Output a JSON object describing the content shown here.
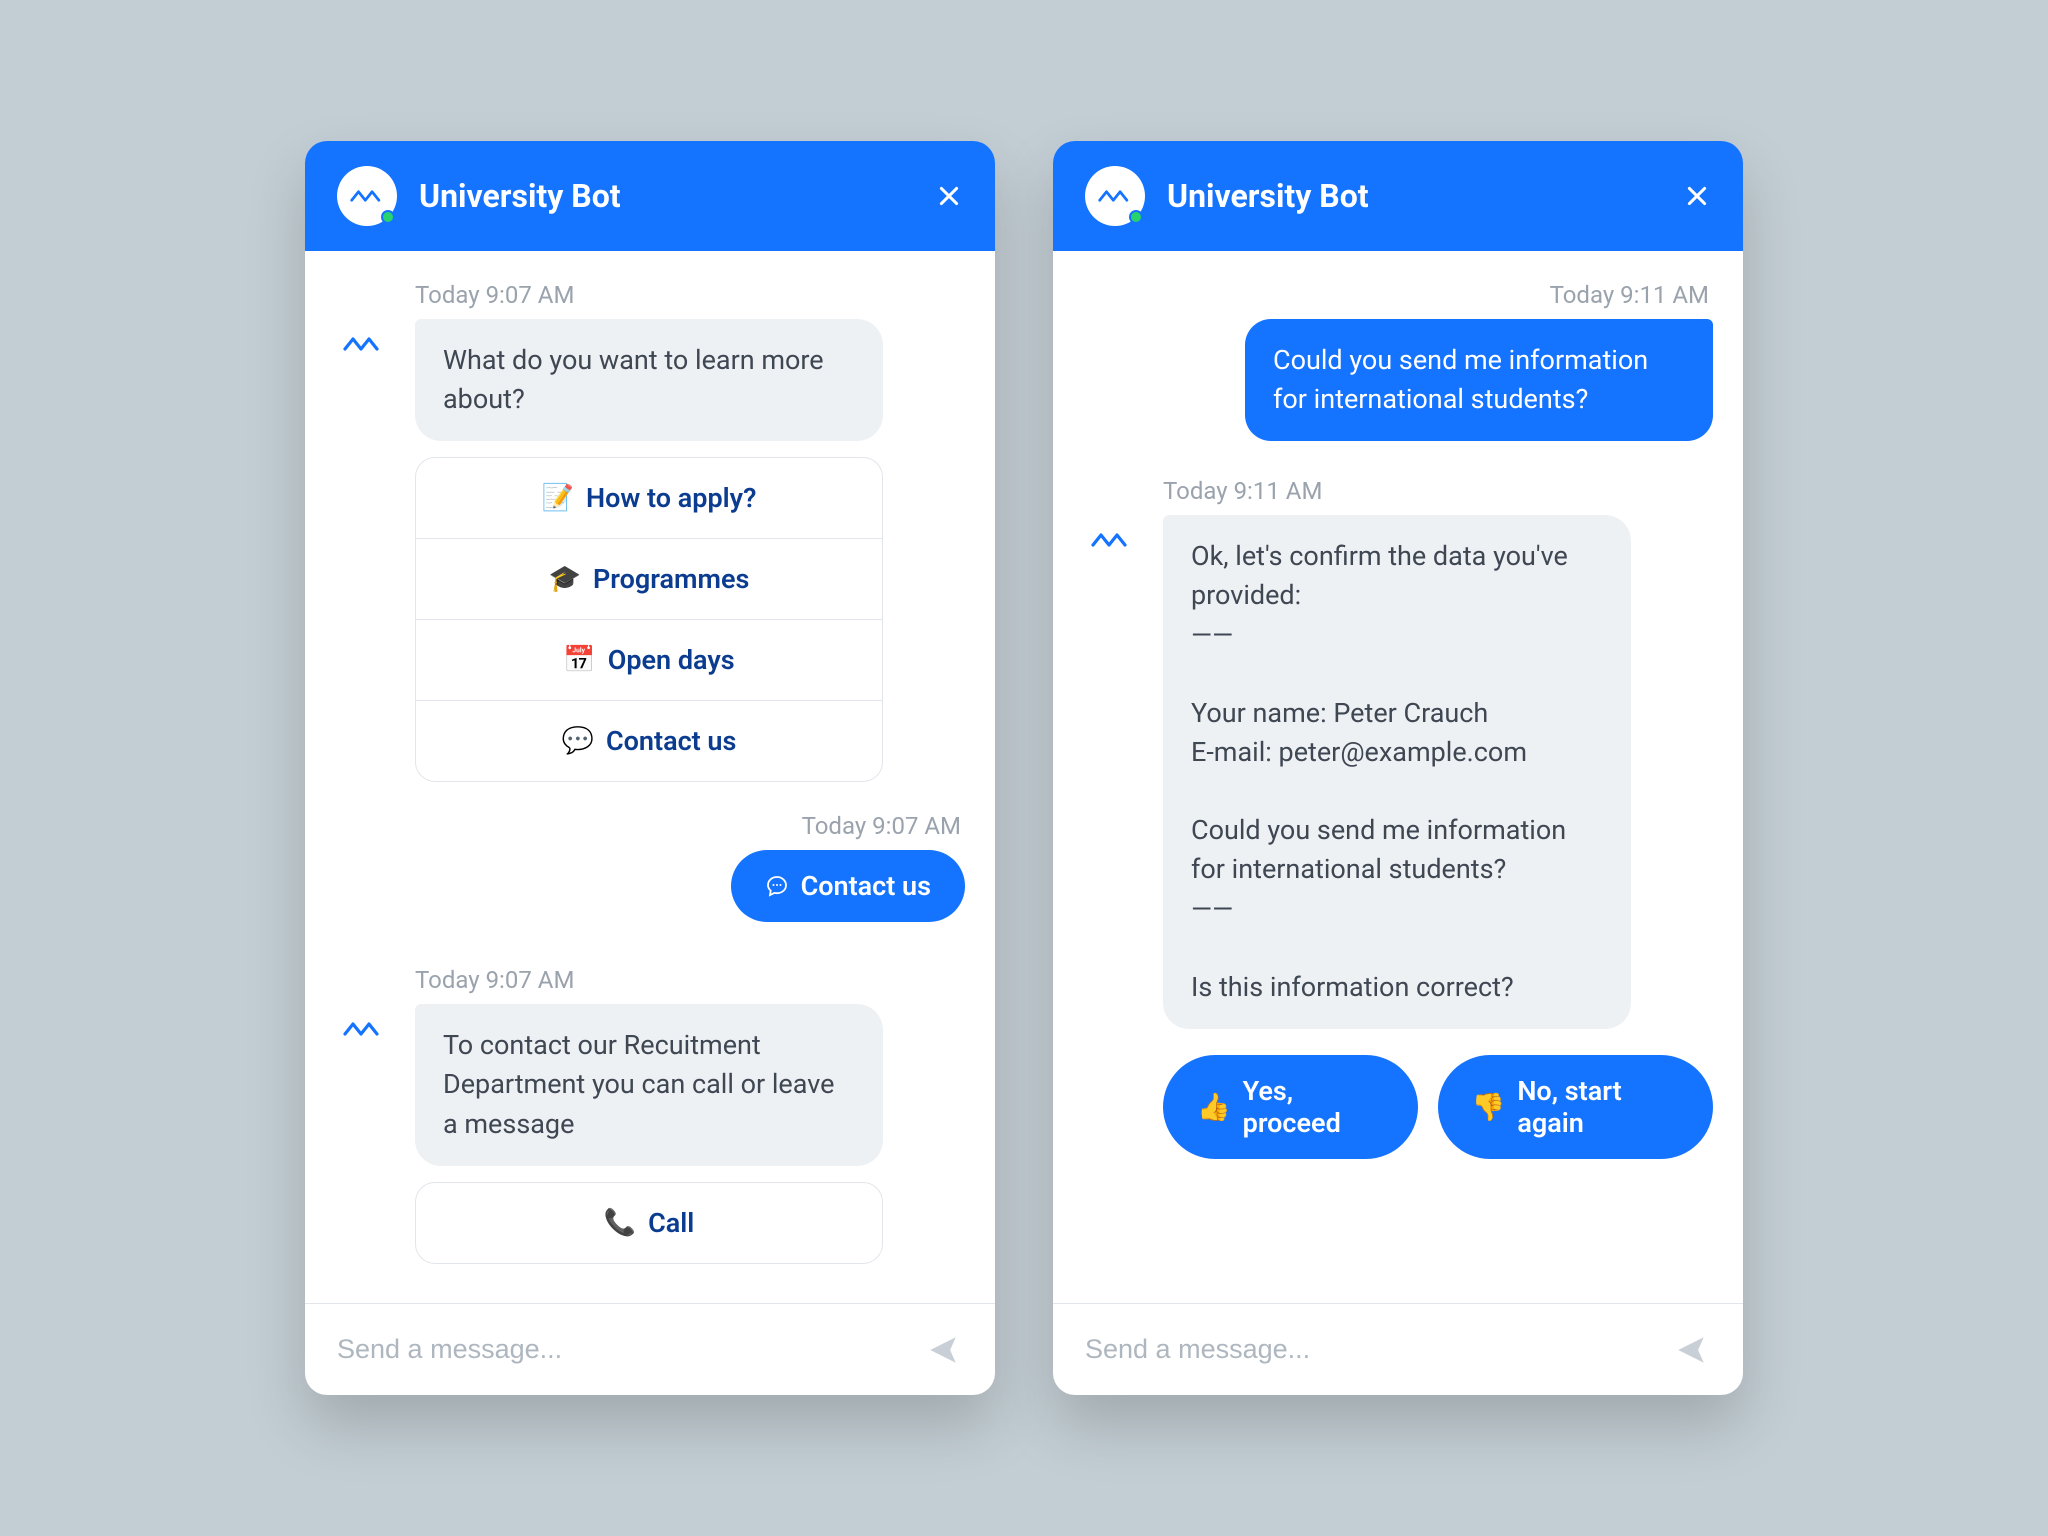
{
  "left": {
    "header": {
      "title": "University Bot"
    },
    "ts1": "Today 9:07 AM",
    "msg1": "What do you want to learn more about?",
    "options": [
      {
        "emoji": "📝",
        "label": "How to apply?"
      },
      {
        "emoji": "🎓",
        "label": "Programmes"
      },
      {
        "emoji": "📅",
        "label": "Open days"
      },
      {
        "emoji": "💬",
        "label": "Contact us"
      }
    ],
    "ts2": "Today 9:07 AM",
    "userReply": "Contact us",
    "ts3": "Today 9:07 AM",
    "msg2": "To contact our Recuitment Department you can call or leave a message",
    "callOption": {
      "emoji": "📞",
      "label": "Call"
    },
    "composer": {
      "placeholder": "Send a message..."
    }
  },
  "right": {
    "header": {
      "title": "University Bot"
    },
    "ts1": "Today 9:11 AM",
    "userMsg": "Could you send me information for international students?",
    "ts2": "Today 9:11 AM",
    "confirmMsg": "Ok, let's confirm the data you've provided:\n——\n\nYour name: Peter Crauch\nE-mail: peter@example.com\n\nCould you send me information for international students?\n——\n\nIs this information correct?",
    "actions": [
      {
        "emoji": "👍",
        "label": "Yes, proceed"
      },
      {
        "emoji": "👎",
        "label": "No, start again"
      }
    ],
    "composer": {
      "placeholder": "Send a message..."
    }
  }
}
